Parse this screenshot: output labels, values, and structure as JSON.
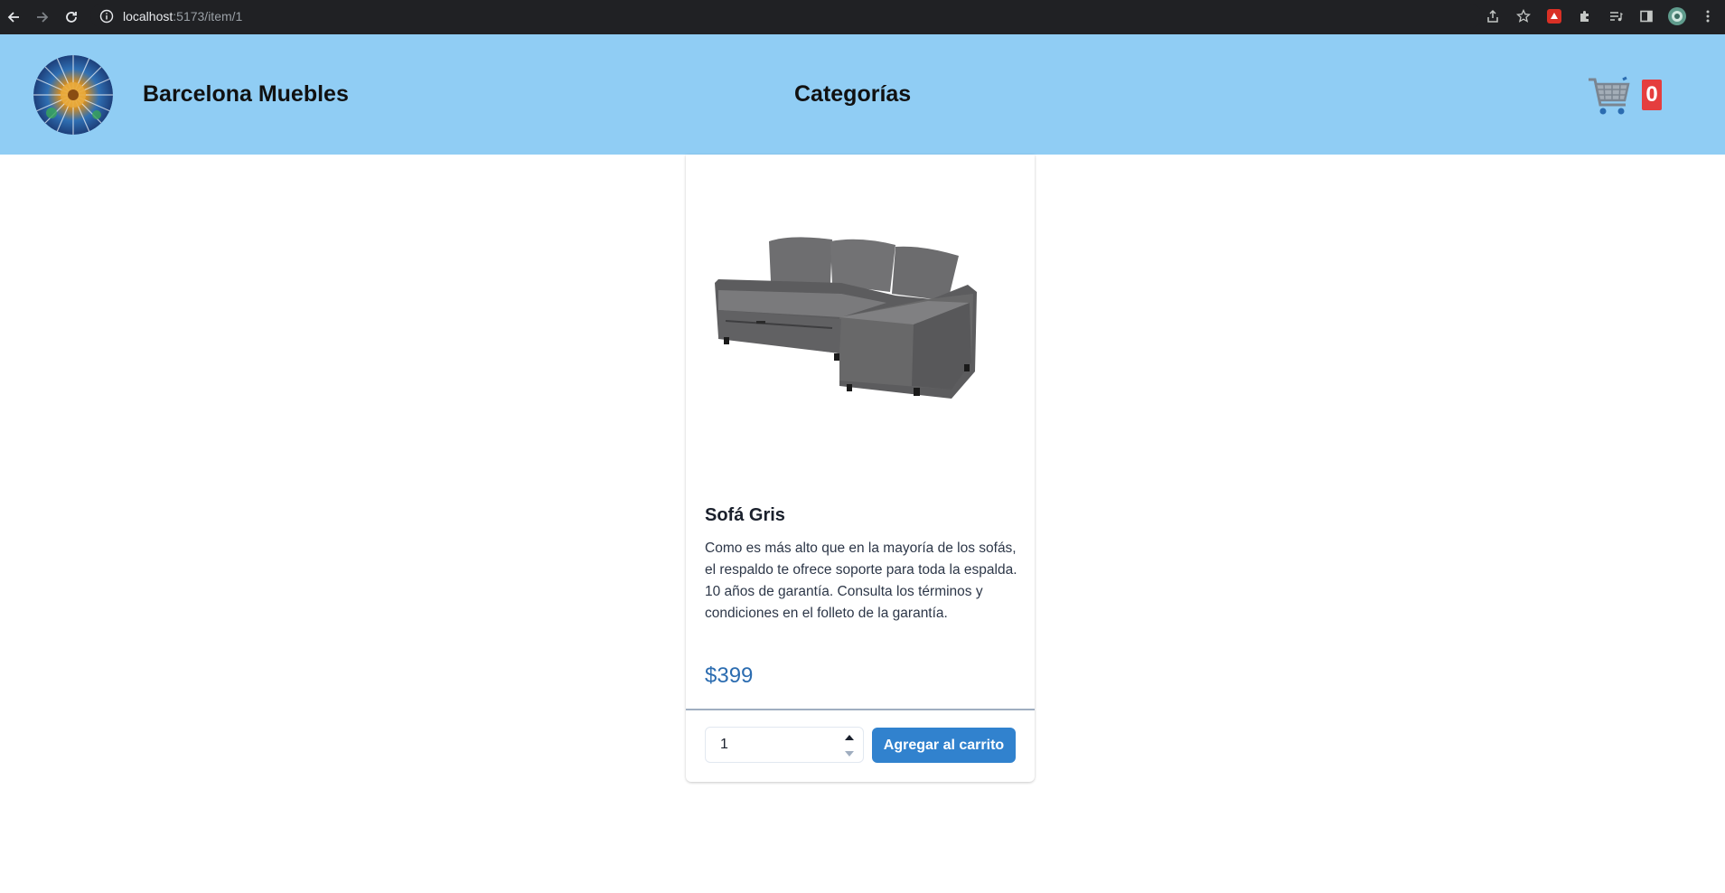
{
  "browser": {
    "url_host": "localhost",
    "url_path": ":5173/item/1"
  },
  "header": {
    "brand": "Barcelona Muebles",
    "nav_categories": "Categorías",
    "cart_count": "0"
  },
  "product": {
    "title": "Sofá Gris",
    "description": "Como es más alto que en la mayoría de los sofás, el respaldo te ofrece soporte para toda la espalda. 10 años de garantía. Consulta los términos y condiciones en el folleto de la garantía.",
    "price": "$399",
    "quantity": "1",
    "add_to_cart_label": "Agregar al carrito"
  },
  "colors": {
    "header_bg": "#90cdf4",
    "accent": "#3182ce",
    "price": "#2b6cb0",
    "badge": "#e53e3e"
  }
}
